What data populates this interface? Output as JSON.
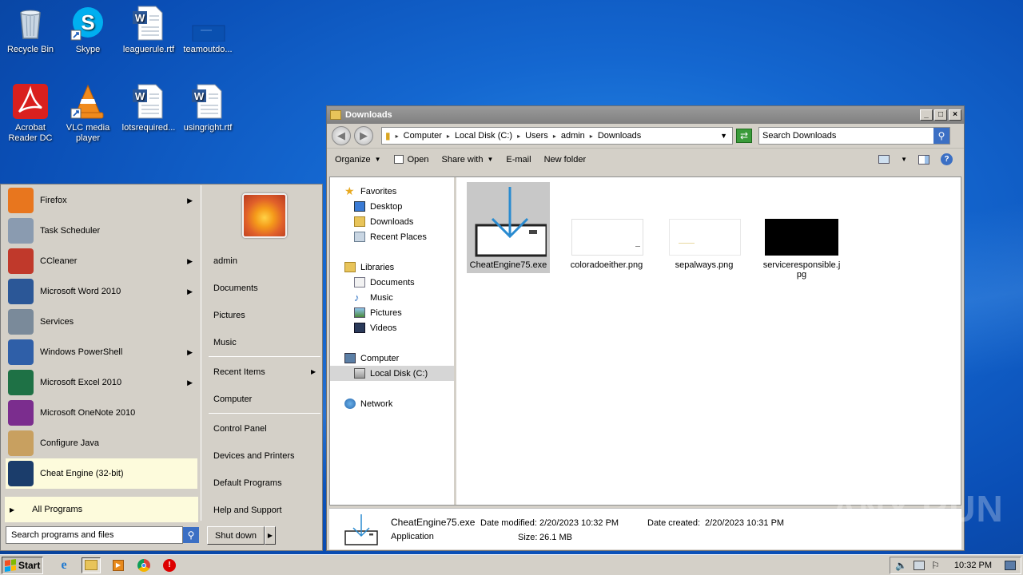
{
  "desktop": {
    "icons": [
      {
        "label": "Recycle Bin",
        "icon": "recycle-bin-icon"
      },
      {
        "label": "Skype",
        "icon": "skype-icon"
      },
      {
        "label": "leaguerule.rtf",
        "icon": "word-document-icon"
      },
      {
        "label": "teamoutdo...",
        "icon": "file-icon"
      },
      {
        "label": "Acrobat Reader DC",
        "icon": "acrobat-icon"
      },
      {
        "label": "VLC media player",
        "icon": "vlc-icon"
      },
      {
        "label": "lotsrequired...",
        "icon": "word-document-icon"
      },
      {
        "label": "usingright.rtf",
        "icon": "word-document-icon"
      }
    ]
  },
  "explorer": {
    "title": "Downloads",
    "breadcrumb": [
      "Computer",
      "Local Disk (C:)",
      "Users",
      "admin",
      "Downloads"
    ],
    "search_placeholder": "Search Downloads",
    "commands": {
      "organize": "Organize",
      "open": "Open",
      "share_with": "Share with",
      "email": "E-mail",
      "new_folder": "New folder"
    },
    "nav": {
      "favorites": "Favorites",
      "desktop": "Desktop",
      "downloads": "Downloads",
      "recent_places": "Recent Places",
      "libraries": "Libraries",
      "documents": "Documents",
      "music": "Music",
      "pictures": "Pictures",
      "videos": "Videos",
      "computer": "Computer",
      "local_disk": "Local Disk (C:)",
      "network": "Network"
    },
    "files": [
      {
        "name": "CheatEngine75.exe",
        "selected": true
      },
      {
        "name": "coloradoeither.png",
        "selected": false
      },
      {
        "name": "sepalways.png",
        "selected": false
      },
      {
        "name": "serviceresponsible.jpg",
        "name_line1": "serviceresponsible.j",
        "name_line2": "pg",
        "selected": false
      }
    ],
    "details": {
      "filename": "CheatEngine75.exe",
      "type": "Application",
      "date_modified_label": "Date modified:",
      "date_modified": "2/20/2023 10:32 PM",
      "size_label": "Size:",
      "size": "26.1 MB",
      "date_created_label": "Date created:",
      "date_created": "2/20/2023 10:31 PM"
    }
  },
  "start_menu": {
    "programs": [
      {
        "label": "Firefox",
        "icon": "firefox-icon",
        "color": "#e8761e",
        "submenu": true
      },
      {
        "label": "Task Scheduler",
        "icon": "clock-icon",
        "color": "#8a9bb0",
        "submenu": false
      },
      {
        "label": "CCleaner",
        "icon": "ccleaner-icon",
        "color": "#c0392b",
        "submenu": true
      },
      {
        "label": "Microsoft Word 2010",
        "icon": "word-icon",
        "color": "#2b5797",
        "submenu": true
      },
      {
        "label": "Services",
        "icon": "gears-icon",
        "color": "#7a8a9a",
        "submenu": false
      },
      {
        "label": "Windows PowerShell",
        "icon": "powershell-icon",
        "color": "#2f5fa8",
        "submenu": true
      },
      {
        "label": "Microsoft Excel 2010",
        "icon": "excel-icon",
        "color": "#1e7145",
        "submenu": true
      },
      {
        "label": "Microsoft OneNote 2010",
        "icon": "onenote-icon",
        "color": "#7b2d8e",
        "submenu": false
      },
      {
        "label": "Configure Java",
        "icon": "java-icon",
        "color": "#c8a060",
        "submenu": false
      },
      {
        "label": "Cheat Engine (32-bit)",
        "icon": "cheat-engine-icon",
        "color": "#1b3d6b",
        "submenu": false,
        "highlighted": true
      }
    ],
    "all_programs": "All Programs",
    "search_placeholder": "Search programs and files",
    "right": {
      "user": "admin",
      "documents": "Documents",
      "pictures": "Pictures",
      "music": "Music",
      "recent_items": "Recent Items",
      "computer": "Computer",
      "control_panel": "Control Panel",
      "devices_printers": "Devices and Printers",
      "default_programs": "Default Programs",
      "help_support": "Help and Support"
    },
    "shutdown": "Shut down"
  },
  "taskbar": {
    "start": "Start",
    "clock": "10:32 PM"
  },
  "watermark": "ANY RUN",
  "colors": {
    "desktop_blue": "#1467d0",
    "selection": "#c8c8c8",
    "highlight": "#fdfbdc",
    "accent": "#3b6fc4"
  }
}
